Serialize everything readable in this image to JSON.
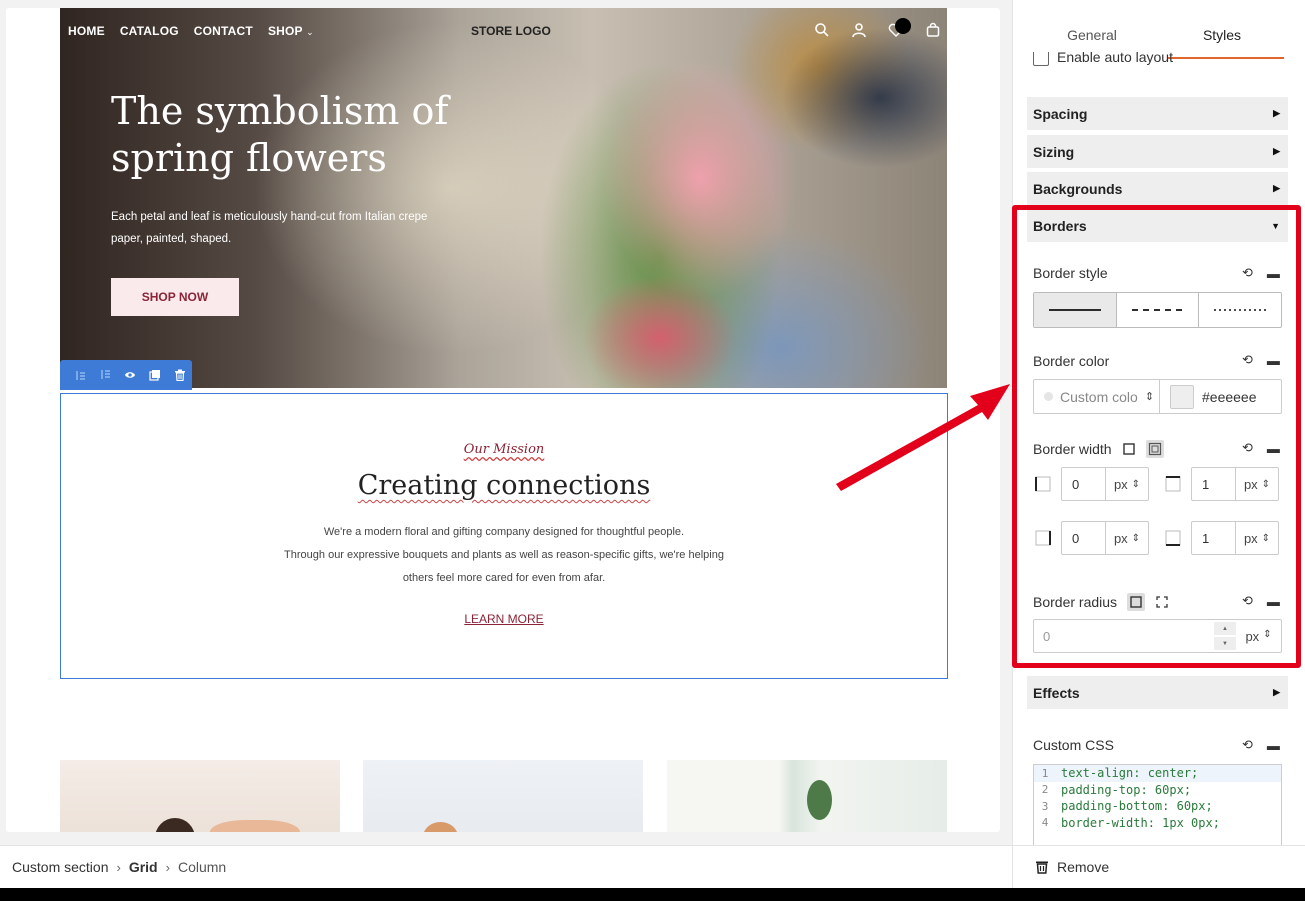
{
  "hero": {
    "nav": [
      "HOME",
      "CATALOG",
      "CONTACT",
      "SHOP"
    ],
    "logo": "STORE LOGO",
    "title": "The symbolism of spring flowers",
    "subtitle": "Each petal and leaf is meticulously hand-cut from Italian crepe paper, painted, shaped.",
    "cta": "SHOP NOW",
    "icons": [
      "search-icon",
      "user-icon",
      "wishlist-icon",
      "cart-icon"
    ]
  },
  "toolbar": {
    "icons": [
      "move-up-icon",
      "move-down-icon",
      "visibility-icon",
      "duplicate-icon",
      "delete-icon"
    ]
  },
  "mission": {
    "eyebrow": "Our Mission",
    "title": "Creating connections",
    "text_lines": [
      "We're a modern floral and gifting company designed for thoughtful people.",
      "Through our expressive bouquets and plants as well as reason-specific gifts, we're helping",
      "others feel more cared for even from afar."
    ],
    "link": "LEARN MORE"
  },
  "breadcrumb": {
    "items": [
      "Custom section",
      "Grid",
      "Column"
    ],
    "separator": "›"
  },
  "panel": {
    "tabs": [
      "General",
      "Styles"
    ],
    "active_tab": "Styles",
    "autolayout_label": "Enable auto layout",
    "sections": {
      "spacing": "Spacing",
      "sizing": "Sizing",
      "backgrounds": "Backgrounds",
      "borders": "Borders",
      "effects": "Effects"
    },
    "border_style": {
      "label": "Border style",
      "options": [
        "solid",
        "dashed",
        "dotted"
      ],
      "selected": "solid"
    },
    "border_color": {
      "label": "Border color",
      "mode": "Custom colo",
      "hex": "#eeeeee"
    },
    "border_width": {
      "label": "Border width",
      "left": "0",
      "top": "1",
      "right": "0",
      "bottom": "1",
      "unit": "px"
    },
    "border_radius": {
      "label": "Border radius",
      "value": "0",
      "unit": "px"
    },
    "custom_css": {
      "label": "Custom CSS",
      "lines": [
        "text-align: center;",
        "padding-top: 60px;",
        "padding-bottom: 60px;",
        "border-width: 1px 0px;"
      ]
    },
    "footer": "Remove"
  },
  "colors": {
    "accent": "#e0662d",
    "selection": "#3d7bd6",
    "highlight": "#e3001b",
    "brand": "#8a2436"
  }
}
